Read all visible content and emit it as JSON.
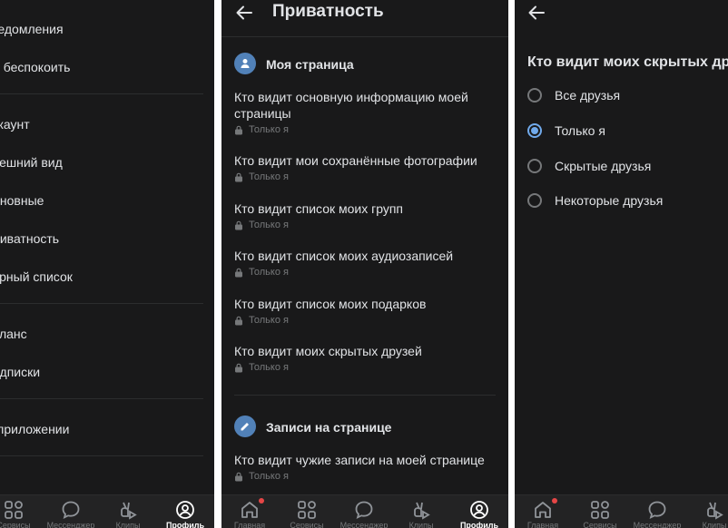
{
  "settings_menu": {
    "group1": [
      "Уведомления",
      "Не беспокоить"
    ],
    "group2": [
      "Аккаунт",
      "Внешний вид",
      "Основные",
      "Приватность",
      "Чёрный список"
    ],
    "group3": [
      "Баланс",
      "Подписки"
    ],
    "group4": [
      "О приложении"
    ]
  },
  "privacy": {
    "title": "Приватность",
    "sections": [
      {
        "title": "Моя страница",
        "icon": "user-icon",
        "items": [
          {
            "title": "Кто видит основную информацию моей страницы",
            "value": "Только я"
          },
          {
            "title": "Кто видит мои сохранённые фотографии",
            "value": "Только я"
          },
          {
            "title": "Кто видит список моих групп",
            "value": "Только я"
          },
          {
            "title": "Кто видит список моих аудиозаписей",
            "value": "Только я"
          },
          {
            "title": "Кто видит список моих подарков",
            "value": "Только я"
          },
          {
            "title": "Кто видит моих скрытых друзей",
            "value": "Только я"
          }
        ]
      },
      {
        "title": "Записи на странице",
        "icon": "pencil-icon",
        "items": [
          {
            "title": "Кто видит чужие записи на моей странице",
            "value": "Только я"
          }
        ]
      }
    ]
  },
  "hidden_friends": {
    "heading": "Кто видит моих скрытых друзей",
    "options": [
      {
        "label": "Все друзья",
        "selected": false
      },
      {
        "label": "Только я",
        "selected": true
      },
      {
        "label": "Скрытые друзья",
        "selected": false
      },
      {
        "label": "Некоторые друзья",
        "selected": false
      }
    ]
  },
  "nav": {
    "home": "Главная",
    "services": "Сервисы",
    "messenger": "Мессенджер",
    "clips": "Клипы",
    "profile": "Профиль"
  },
  "colors": {
    "background": "#19191a",
    "text": "#e1e3e6",
    "secondary": "#76787a",
    "accent": "#71aaeb",
    "badge": "#e64646"
  }
}
